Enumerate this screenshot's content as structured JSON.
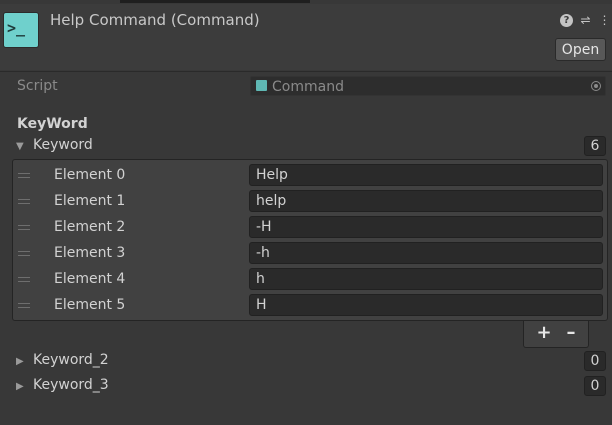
{
  "header": {
    "title": "Help Command (Command)",
    "icon": "terminal-prompt-icon",
    "icon_glyph": ">_",
    "open_label": "Open",
    "icon_color": "#6fd0cc"
  },
  "script_field": {
    "label": "Script",
    "value": "Command"
  },
  "section": {
    "title": "KeyWord"
  },
  "keyword": {
    "label": "Keyword",
    "count": "6",
    "elements": [
      {
        "label": "Element 0",
        "value": "Help"
      },
      {
        "label": "Element 1",
        "value": "help"
      },
      {
        "label": "Element 2",
        "value": "-H"
      },
      {
        "label": "Element 3",
        "value": "-h"
      },
      {
        "label": "Element 4",
        "value": "h"
      },
      {
        "label": "Element 5",
        "value": "H"
      }
    ],
    "add_label": "+",
    "remove_label": "–"
  },
  "keyword_2": {
    "label": "Keyword_2",
    "count": "0"
  },
  "keyword_3": {
    "label": "Keyword_3",
    "count": "0"
  }
}
